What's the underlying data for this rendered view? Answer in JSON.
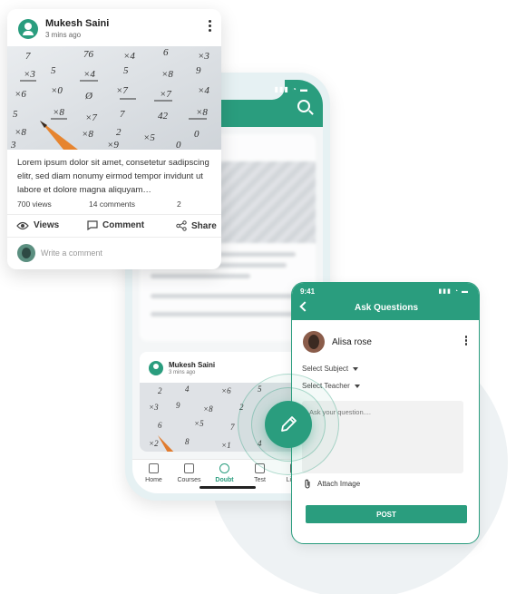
{
  "post_card": {
    "author": "Mukesh Saini",
    "time": "3 mins ago",
    "body": "Lorem ipsum dolor sit amet, consetetur sadipscing elitr, sed diam nonumy eirmod tempor invidunt ut labore et dolore magna aliquyam…",
    "views": "700 views",
    "comments": "14 comments",
    "shares": "2",
    "actions": {
      "views": "Views",
      "comment": "Comment",
      "share": "Share"
    },
    "comment_placeholder": "Write a comment"
  },
  "feed_phone": {
    "post": {
      "author": "Mukesh Saini",
      "time": "3 mins ago"
    },
    "nav": [
      {
        "label": "Home"
      },
      {
        "label": "Courses"
      },
      {
        "label": "Doubt"
      },
      {
        "label": "Test"
      },
      {
        "label": "Live C"
      }
    ]
  },
  "ask_phone": {
    "status_time": "9:41",
    "title": "Ask Questions",
    "user": "Alisa rose",
    "select_subject": "Select Subject",
    "select_teacher": "Select Teacher",
    "question_placeholder": "Ask your question....",
    "attach_label": "Attach Image",
    "post_label": "POST"
  },
  "colors": {
    "brand": "#2a9d7e"
  }
}
